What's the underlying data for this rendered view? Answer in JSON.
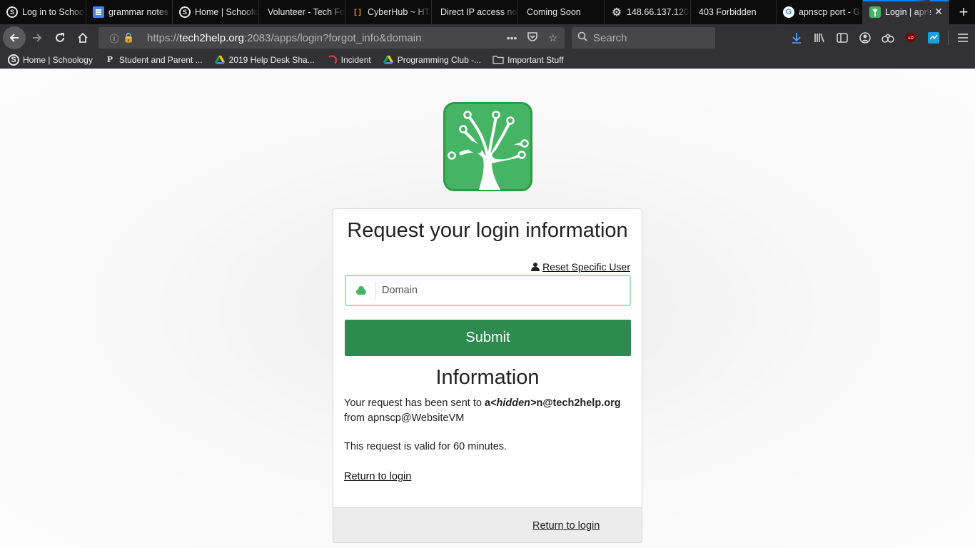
{
  "tabs": [
    {
      "label": "Log in to Schoology",
      "favicon": "schoology-icon"
    },
    {
      "label": "grammar notes",
      "favicon": "google-docs-icon"
    },
    {
      "label": "Home | Schoology",
      "favicon": "schoology-icon"
    },
    {
      "label": "Volunteer - Tech For",
      "favicon": "none"
    },
    {
      "label": "CyberHub ~ HTML",
      "favicon": "code-icon"
    },
    {
      "label": "Direct IP access not",
      "favicon": "none"
    },
    {
      "label": "Coming Soon",
      "favicon": "none"
    },
    {
      "label": "148.66.137.120",
      "favicon": "gear-icon"
    },
    {
      "label": "403 Forbidden",
      "favicon": "none"
    },
    {
      "label": "apnscp port - Google",
      "favicon": "google-icon"
    },
    {
      "label": "Login | apnscp",
      "favicon": "tree-icon",
      "active": true
    }
  ],
  "navbar": {
    "url_prefix": "https://",
    "url_host": "tech2help.org",
    "url_rest": ":2083/apps/login?forgot_info&domain",
    "search_placeholder": "Search"
  },
  "bookmarks": [
    {
      "label": "Home | Schoology",
      "icon": "schoology-icon"
    },
    {
      "label": "Student and Parent ...",
      "icon": "powerschool-icon"
    },
    {
      "label": "2019 Help Desk Sha...",
      "icon": "google-drive-icon"
    },
    {
      "label": "Incident",
      "icon": "servicenow-icon"
    },
    {
      "label": "Programming Club -...",
      "icon": "google-drive-icon"
    },
    {
      "label": "Important Stuff",
      "icon": "folder-icon"
    }
  ],
  "card": {
    "title": "Request your login information",
    "reset_link": "Reset Specific User",
    "domain_placeholder": "Domain",
    "submit_label": "Submit",
    "info_heading": "Information",
    "info_prefix": "Your request has been sent to ",
    "email_a": "a",
    "email_hidden": "<hidden>",
    "email_rest": "n@tech2help.org",
    "info_suffix": " from apnscp@WebsiteVM",
    "valid_text": "This request is valid for 60 minutes.",
    "return_link": "Return to login",
    "footer_return_link": "Return to login"
  },
  "colors": {
    "brand_green": "#2e8b4f",
    "logo_green": "#45b465",
    "accent_blue": "#0a84ff"
  }
}
